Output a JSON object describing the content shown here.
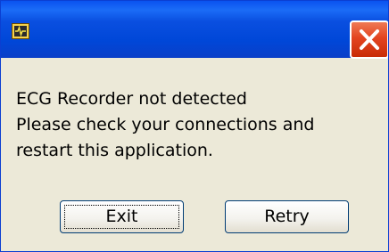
{
  "dialog": {
    "title": "",
    "app_icon": "labview-app-icon",
    "close_icon": "close-icon",
    "message_lines": [
      "ECG Recorder not detected",
      "Please check your connections and",
      "restart this application."
    ],
    "buttons": {
      "exit_label": "Exit",
      "retry_label": "Retry"
    }
  },
  "colors": {
    "titlebar": "#0047d8",
    "close_button": "#e34420",
    "body_background": "#ece9d8"
  }
}
